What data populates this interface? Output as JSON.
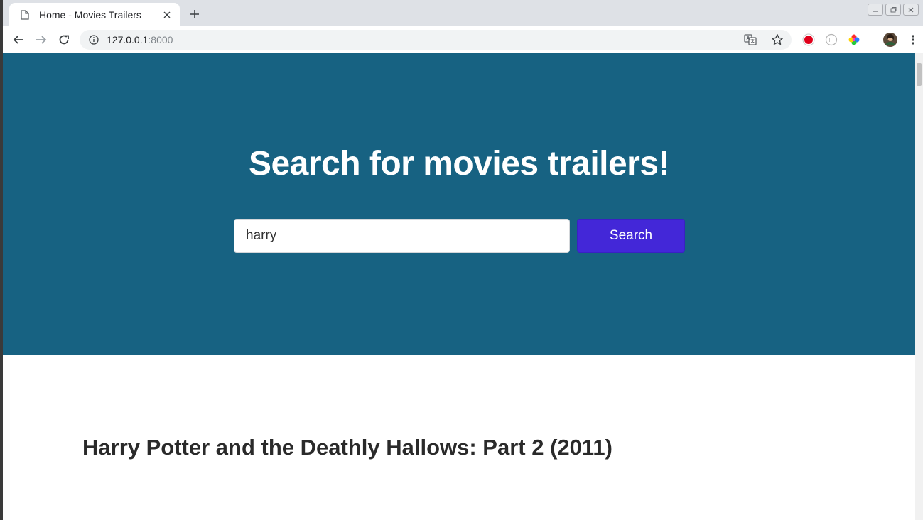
{
  "browser": {
    "tab_title": "Home - Movies Trailers",
    "url_host": "127.0.0.1",
    "url_port": ":8000"
  },
  "hero": {
    "heading": "Search for movies trailers!",
    "search_value": "harry",
    "search_button_label": "Search",
    "background_color": "#176282",
    "button_color": "#4327d8"
  },
  "results": [
    {
      "title": "Harry Potter and the Deathly Hallows: Part 2 (2011)"
    }
  ],
  "icons": {
    "tab": [
      "page-icon",
      "close-icon",
      "plus-icon"
    ],
    "toolbar": [
      "back-arrow-icon",
      "forward-arrow-icon",
      "reload-icon",
      "info-icon",
      "translate-icon",
      "star-icon"
    ],
    "extensions": [
      "record-icon",
      "circle-extension-icon",
      "color-wheel-icon",
      "profile-avatar",
      "menu-dots-icon"
    ]
  }
}
